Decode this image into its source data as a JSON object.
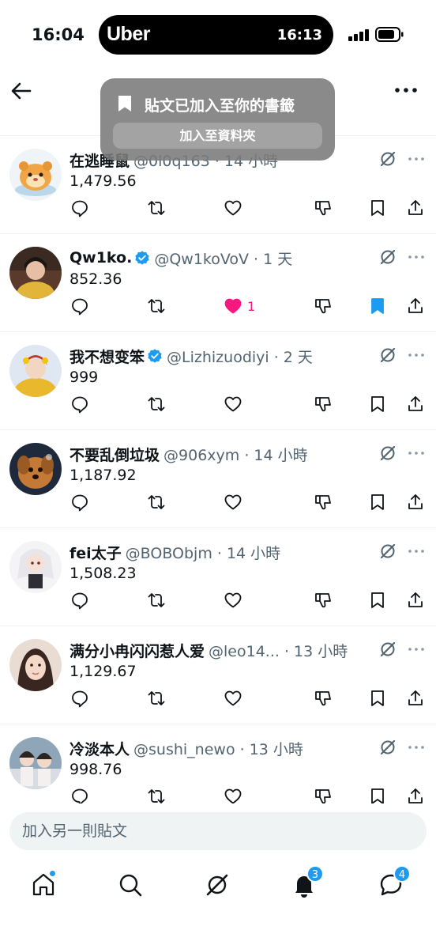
{
  "status_bar": {
    "time": "16:04",
    "live_activity_app": "Uber",
    "live_activity_time": "16:13"
  },
  "toast": {
    "title": "貼文已加入至你的書籤",
    "action_label": "加入至資料夾"
  },
  "posts": [
    {
      "name": "在逃睡鼠",
      "handle": "@0l0q163 · 14 小時",
      "text": "1,479.56",
      "verified": false,
      "liked": false,
      "like_count": "",
      "bookmarked": false
    },
    {
      "name": "Qw1ko.",
      "handle": "@Qw1koVoV · 1 天",
      "text": "852.36",
      "verified": true,
      "liked": true,
      "like_count": "1",
      "bookmarked": true
    },
    {
      "name": "我不想变笨",
      "handle": "@Lizhizuodiyi · 2 天",
      "text": "999",
      "verified": true,
      "liked": false,
      "like_count": "",
      "bookmarked": false
    },
    {
      "name": "不要乱倒垃圾",
      "handle": "@906xym · 14 小時",
      "text": "1,187.92",
      "verified": false,
      "liked": false,
      "like_count": "",
      "bookmarked": false
    },
    {
      "name": "fei太子",
      "handle": "@BOBObjm · 14 小時",
      "text": "1,508.23",
      "verified": false,
      "liked": false,
      "like_count": "",
      "bookmarked": false
    },
    {
      "name": "满分小冉闪闪惹人爱",
      "handle": "@leo14... · 13 小時",
      "text": "1,129.67",
      "verified": false,
      "liked": false,
      "like_count": "",
      "bookmarked": false
    },
    {
      "name": "冷淡本人",
      "handle": "@sushi_newo · 13 小時",
      "text": "998.76",
      "verified": false,
      "liked": false,
      "like_count": "",
      "bookmarked": false
    }
  ],
  "composer": {
    "placeholder": "加入另一則貼文"
  },
  "bottom_nav": {
    "notifications_badge": "3",
    "messages_badge": "4"
  },
  "colors": {
    "accent": "#1d9bf0",
    "like": "#f91880",
    "text": "#0f1419",
    "muted": "#536471"
  }
}
